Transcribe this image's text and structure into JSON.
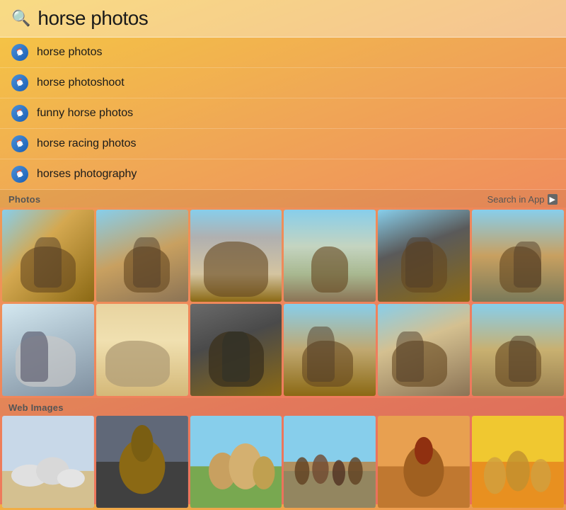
{
  "search": {
    "query": "horse photos",
    "icon": "🔍"
  },
  "suggestions": [
    {
      "id": "s1",
      "label": "horse photos"
    },
    {
      "id": "s2",
      "label": "horse photoshoot"
    },
    {
      "id": "s3",
      "label": "funny horse photos"
    },
    {
      "id": "s4",
      "label": "horse racing photos"
    },
    {
      "id": "s5",
      "label": "horses photography"
    }
  ],
  "photos_section": {
    "title": "Photos",
    "search_in_app": "Search in App"
  },
  "web_images_section": {
    "title": "Web Images"
  },
  "photo_cells": [
    {
      "id": "p1",
      "cls": "p1"
    },
    {
      "id": "p2",
      "cls": "p2"
    },
    {
      "id": "p3",
      "cls": "p3"
    },
    {
      "id": "p4",
      "cls": "p4"
    },
    {
      "id": "p5",
      "cls": "p5"
    },
    {
      "id": "p6",
      "cls": "p6"
    },
    {
      "id": "p7",
      "cls": "p7"
    },
    {
      "id": "p8",
      "cls": "p8"
    },
    {
      "id": "p9",
      "cls": "p9"
    },
    {
      "id": "p10",
      "cls": "p10"
    },
    {
      "id": "p11",
      "cls": "p11"
    },
    {
      "id": "p12",
      "cls": "p12"
    }
  ],
  "web_cells": [
    {
      "id": "w1",
      "cls": "w1"
    },
    {
      "id": "w2",
      "cls": "w2"
    },
    {
      "id": "w3",
      "cls": "w3"
    },
    {
      "id": "w4",
      "cls": "w4"
    },
    {
      "id": "w5",
      "cls": "w5"
    },
    {
      "id": "w6",
      "cls": "w6"
    }
  ]
}
